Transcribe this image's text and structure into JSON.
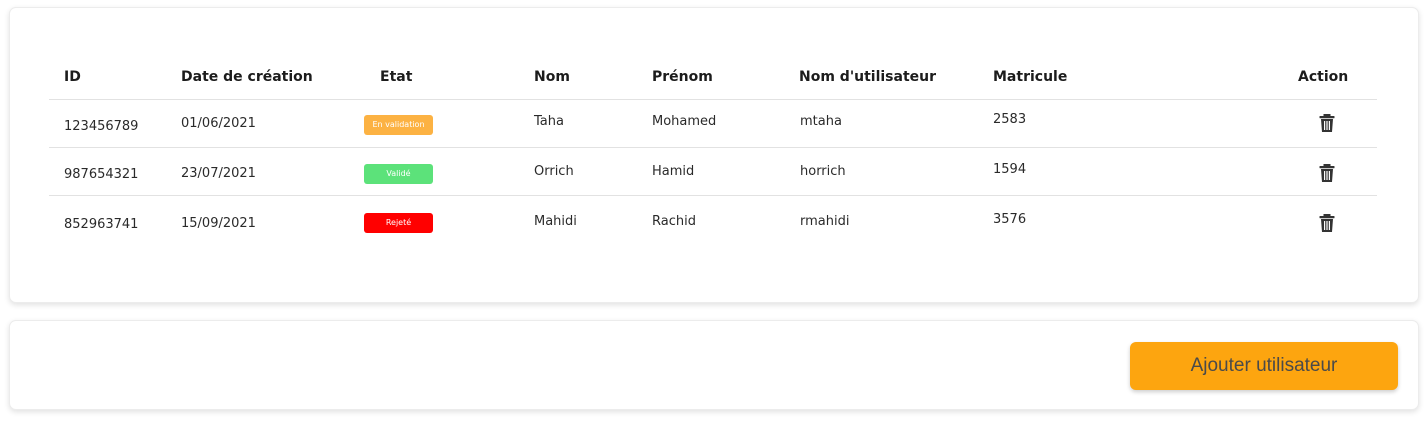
{
  "table": {
    "headers": {
      "id": "ID",
      "date": "Date de création",
      "etat": "Etat",
      "nom": "Nom",
      "prenom": "Prénom",
      "username": "Nom d'utilisateur",
      "matricule": "Matricule",
      "action": "Action"
    },
    "rows": [
      {
        "id": "123456789",
        "date": "01/06/2021",
        "etat": "En validation",
        "etat_color": "#fcb243",
        "nom": "Taha",
        "prenom": "Mohamed",
        "username": "mtaha",
        "matricule": "2583",
        "action_icon": "trash-icon"
      },
      {
        "id": "987654321",
        "date": "23/07/2021",
        "etat": "Validé",
        "etat_color": "#5ce27a",
        "nom": "Orrich",
        "prenom": "Hamid",
        "username": "horrich",
        "matricule": "1594",
        "action_icon": "trash-icon"
      },
      {
        "id": "852963741",
        "date": "15/09/2021",
        "etat": "Rejeté",
        "etat_color": "#ff0000",
        "nom": "Mahidi",
        "prenom": "Rachid",
        "username": "rmahidi",
        "matricule": "3576",
        "action_icon": "trash-icon"
      }
    ]
  },
  "actions": {
    "add_user_label": "Ajouter utilisateur",
    "add_user_color": "#fda50f"
  }
}
